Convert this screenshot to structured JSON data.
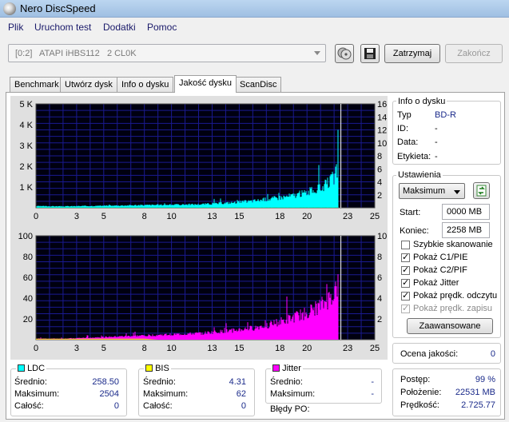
{
  "window": {
    "title": "Nero DiscSpeed"
  },
  "menu": [
    "Plik",
    "Uruchom test",
    "Dodatki",
    "Pomoc"
  ],
  "toolbar": {
    "drive_value": "[0:2]   ATAPI iHBS112   2 CL0K",
    "stop_label": "Zatrzymaj",
    "finish_label": "Zakończ"
  },
  "tabs": [
    "Benchmark",
    "Utwórz dysk",
    "Info o dysku",
    "Jakość dysku",
    "ScanDisc"
  ],
  "active_tab": "Jakość dysku",
  "chart_data": [
    {
      "type": "area",
      "x_ticks": [
        "0",
        "3",
        "5",
        "8",
        "10",
        "13",
        "15",
        "18",
        "20",
        "23",
        "25"
      ],
      "y_ticks_left": [
        "1 K",
        "2 K",
        "3 K",
        "4 K",
        "5 K"
      ],
      "y_ticks_right": [
        "2",
        "4",
        "6",
        "8",
        "10",
        "12",
        "14",
        "16"
      ],
      "xlim": [
        0,
        25
      ],
      "ylim_left": [
        0,
        5000
      ],
      "ylim_right": [
        0,
        16
      ],
      "marker_x": 22.5,
      "series": [
        {
          "color": "#00ffff",
          "x": [
            0,
            2,
            4,
            6,
            8,
            10,
            12,
            14,
            16,
            18,
            19,
            20,
            21,
            21.5,
            22,
            22.3
          ],
          "values": [
            80,
            70,
            90,
            110,
            130,
            150,
            170,
            230,
            330,
            500,
            600,
            750,
            950,
            1150,
            1500,
            1900
          ]
        },
        {
          "color": "#00a000",
          "x": [
            0,
            5,
            10,
            15,
            20,
            22.3
          ],
          "values": [
            12,
            12,
            12,
            12,
            12,
            12
          ]
        }
      ]
    },
    {
      "type": "bar",
      "x_ticks": [
        "0",
        "3",
        "5",
        "8",
        "10",
        "13",
        "15",
        "18",
        "20",
        "23",
        "25"
      ],
      "y_ticks_left": [
        "20",
        "40",
        "60",
        "80",
        "100"
      ],
      "y_ticks_right": [
        "2",
        "4",
        "6",
        "8",
        "10"
      ],
      "xlim": [
        0,
        25
      ],
      "ylim_left": [
        0,
        100
      ],
      "ylim_right": [
        0,
        10
      ],
      "marker_x": 22.5,
      "series": [
        {
          "color": "#ff00ff",
          "x": [
            0,
            2,
            4,
            6,
            8,
            10,
            12,
            14,
            16,
            17,
            18,
            19,
            20,
            21,
            21.5,
            22,
            22.3
          ],
          "values": [
            1,
            1,
            2,
            3,
            4,
            5,
            6,
            8,
            11,
            14,
            17,
            21,
            26,
            32,
            37,
            45,
            52
          ]
        },
        {
          "color": "#ffff00",
          "x": [
            0,
            8,
            9,
            22.3
          ],
          "values": [
            1,
            1,
            0,
            0
          ]
        }
      ]
    }
  ],
  "disc_info": {
    "title": "Info o dysku",
    "type_label": "Typ",
    "type_value": "BD-R",
    "id_label": "ID:",
    "id_value": "-",
    "date_label": "Data:",
    "date_value": "-",
    "tag_label": "Etykieta:",
    "tag_value": "-"
  },
  "settings": {
    "title": "Ustawienia",
    "speed_value": "Maksimum",
    "start_label": "Start:",
    "start_value": "0000 MB",
    "end_label": "Koniec:",
    "end_value": "2258 MB",
    "options": [
      {
        "label": "Szybkie skanowanie",
        "checked": false,
        "disabled": false
      },
      {
        "label": "Pokaż C1/PIE",
        "checked": true,
        "disabled": false
      },
      {
        "label": "Pokaż C2/PIF",
        "checked": true,
        "disabled": false
      },
      {
        "label": "Pokaż Jitter",
        "checked": true,
        "disabled": false
      },
      {
        "label": "Pokaż prędk. odczytu",
        "checked": true,
        "disabled": false
      },
      {
        "label": "Pokaż prędk. zapisu",
        "checked": true,
        "disabled": true
      }
    ],
    "advanced_label": "Zaawansowane"
  },
  "quality": {
    "label": "Ocena jakości:",
    "value": "0"
  },
  "ldc": {
    "title": "LDC",
    "color": "#00ffff",
    "avg_label": "Średnio:",
    "avg": "258.50",
    "max_label": "Maksimum:",
    "max": "2504",
    "total_label": "Całość:",
    "total": "0"
  },
  "bis": {
    "title": "BIS",
    "color": "#ffff00",
    "avg_label": "Średnio:",
    "avg": "4.31",
    "max_label": "Maksimum:",
    "max": "62",
    "total_label": "Całość:",
    "total": "0"
  },
  "jitter": {
    "title": "Jitter",
    "color": "#ff00ff",
    "avg_label": "Średnio:",
    "avg": "-",
    "max_label": "Maksimum:",
    "max": "-"
  },
  "po_errors": {
    "label": "Błędy PO:"
  },
  "progress": {
    "progress_label": "Postęp:",
    "progress_value": "99 %",
    "position_label": "Położenie:",
    "position_value": "22531 MB",
    "speed_label": "Prędkość:",
    "speed_value": "2.725.77"
  }
}
